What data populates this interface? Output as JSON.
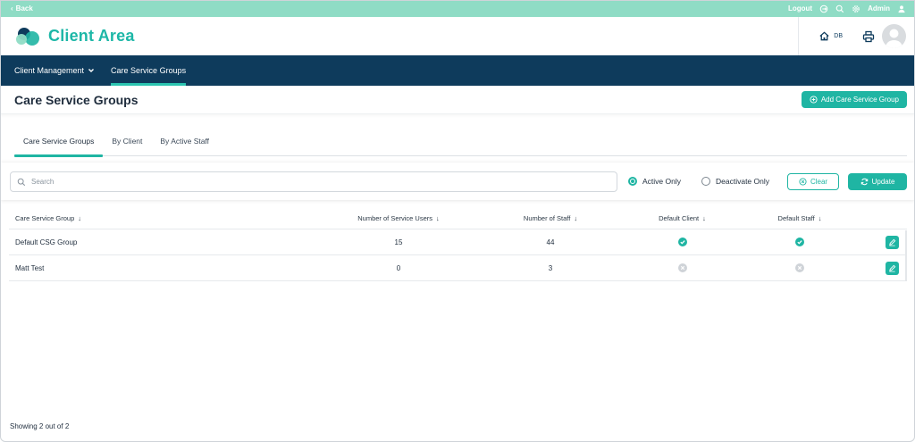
{
  "topbar": {
    "back_label": "Back",
    "logout_label": "Logout",
    "admin_label": "Admin"
  },
  "header": {
    "app_title": "Client Area",
    "user_initials": "DB"
  },
  "nav": {
    "items": [
      {
        "label": "Client Management"
      },
      {
        "label": "Care Service Groups"
      }
    ]
  },
  "page": {
    "title": "Care Service Groups",
    "add_button_label": "Add Care Service Group"
  },
  "tabs": [
    {
      "label": "Care Service Groups"
    },
    {
      "label": "By Client"
    },
    {
      "label": "By Active Staff"
    }
  ],
  "filters": {
    "search_placeholder": "Search",
    "search_value": "",
    "radio_active": "Active Only",
    "radio_deactivate": "Deactivate Only",
    "selected": "Active Only",
    "clear_label": "Clear",
    "update_label": "Update"
  },
  "table": {
    "columns": [
      "Care Service Group",
      "Number of Service Users",
      "Number of Staff",
      "Default Client",
      "Default Staff"
    ],
    "rows": [
      {
        "name": "Default CSG Group",
        "service_users": "15",
        "staff": "44",
        "default_client": "yes",
        "default_staff": "yes"
      },
      {
        "name": "Matt Test",
        "service_users": "0",
        "staff": "3",
        "default_client": "no",
        "default_staff": "no"
      }
    ]
  },
  "footer": {
    "showing": "Showing 2 out of 2"
  },
  "colors": {
    "accent": "#1fb5a3",
    "topbar": "#8fdcc5",
    "navbar": "#0e3b5c"
  }
}
